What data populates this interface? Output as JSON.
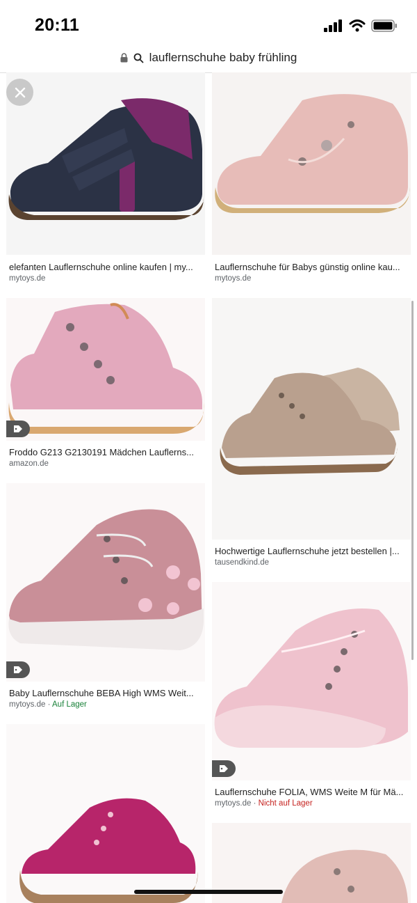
{
  "status_bar": {
    "time": "20:11"
  },
  "search": {
    "query": "lauflernschuhe baby frühling"
  },
  "results": [
    {
      "title": "elefanten Lauflernschuhe online kaufen | my...",
      "source": "mytoys.de",
      "stock": ""
    },
    {
      "title": "Lauflernschuhe für Babys günstig online kau...",
      "source": "mytoys.de",
      "stock": ""
    },
    {
      "title": "Froddo G213 G2130191 Mädchen Lauflerns...",
      "source": "amazon.de",
      "stock": ""
    },
    {
      "title": "Hochwertige Lauflernschuhe jetzt bestellen |...",
      "source": "tausendkind.de",
      "stock": ""
    },
    {
      "title": "Baby Lauflernschuhe BEBA High WMS Weit...",
      "source": "mytoys.de",
      "stock": "Auf Lager"
    },
    {
      "title": "Lauflernschuhe FOLIA, WMS Weite M für Mä...",
      "source": "mytoys.de",
      "stock": "Nicht auf Lager"
    }
  ],
  "colors": {
    "in_stock": "#188038",
    "out_of_stock": "#c5221f",
    "link_gray": "#5f6368"
  },
  "icons": {
    "close": "close-icon",
    "lock": "lock-icon",
    "search": "search-icon",
    "tag": "price-tag-icon"
  }
}
